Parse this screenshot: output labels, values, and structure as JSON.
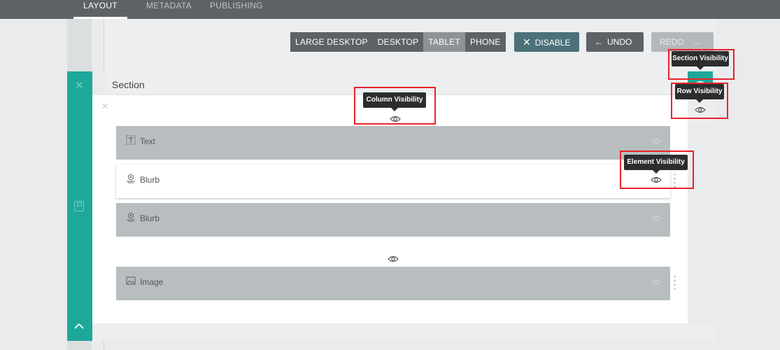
{
  "tabs": [
    {
      "label": "LAYOUT",
      "active": true
    },
    {
      "label": "METADATA",
      "active": false
    },
    {
      "label": "PUBLISHING",
      "active": false
    }
  ],
  "toolbar": {
    "devices": [
      {
        "label": "LARGE DESKTOP",
        "active": false
      },
      {
        "label": "DESKTOP",
        "active": false
      },
      {
        "label": "TABLET",
        "active": true
      },
      {
        "label": "PHONE",
        "active": false
      }
    ],
    "disable_label": "DISABLE",
    "undo_label": "UNDO",
    "redo_label": "REDO"
  },
  "section": {
    "title": "Section"
  },
  "modules": [
    {
      "label": "Text",
      "icon": "text-icon",
      "visible": false
    },
    {
      "label": "Blurb",
      "icon": "blurb-icon",
      "visible": true
    },
    {
      "label": "Blurb",
      "icon": "blurb-icon",
      "visible": false
    },
    {
      "label": "Image",
      "icon": "image-icon",
      "visible": false
    }
  ],
  "tooltips": {
    "section": "Section Visibility",
    "row": "Row Visibility",
    "column": "Column Visibility",
    "element": "Element Visibility"
  },
  "colors": {
    "accent_green": "#1ea89a",
    "highlight_red": "#e8232b",
    "topbar": "#5e6266",
    "disable_button": "#4c7179"
  }
}
